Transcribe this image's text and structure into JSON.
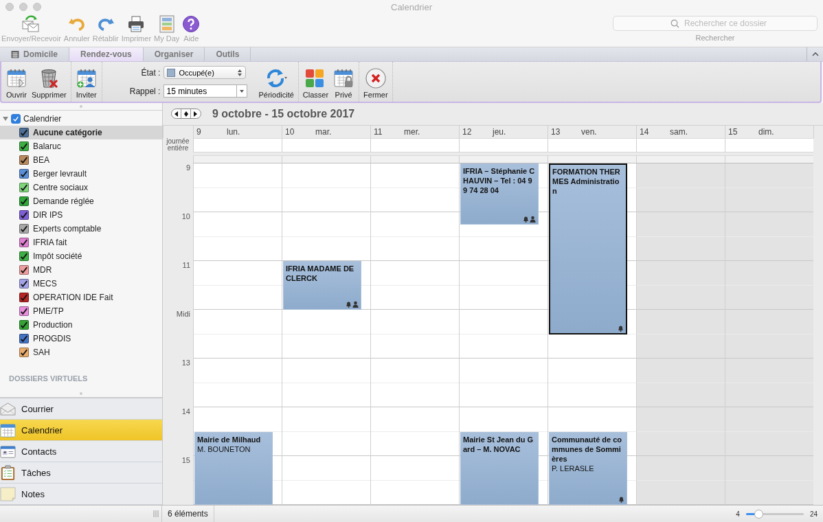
{
  "window": {
    "title": "Calendrier"
  },
  "toolbar": {
    "buttons": [
      {
        "label": "Envoyer/Recevoir"
      },
      {
        "label": "Annuler"
      },
      {
        "label": "Rétablir"
      },
      {
        "label": "Imprimer"
      },
      {
        "label": "My Day"
      },
      {
        "label": "Aide"
      }
    ],
    "search": {
      "placeholder": "Rechercher ce dossier",
      "label": "Rechercher"
    }
  },
  "ribbon_tabs": [
    {
      "label": "Domicile",
      "selected": false
    },
    {
      "label": "Rendez-vous",
      "selected": true
    },
    {
      "label": "Organiser",
      "selected": false
    },
    {
      "label": "Outils",
      "selected": false
    }
  ],
  "ribbon": {
    "open": "Ouvrir",
    "delete": "Supprimer",
    "invite": "Inviter",
    "status": {
      "label": "État :",
      "value": "Occupé(e)"
    },
    "reminder": {
      "label": "Rappel :",
      "value": "15 minutes"
    },
    "recurrence": "Périodicité",
    "categorize": "Classer",
    "private": "Privé",
    "close": "Fermer"
  },
  "sidebar": {
    "tree": [
      {
        "label": "Calendrier",
        "checked": true,
        "expanded": true,
        "children": [
          {
            "label": "Aucune catégorie",
            "checked": true,
            "selected": true,
            "color": "#4d6f96"
          },
          {
            "label": "Balaruc",
            "checked": true,
            "selected": false,
            "color": "#3fae44"
          },
          {
            "label": "BEA",
            "checked": true,
            "selected": false,
            "color": "#b8895e"
          },
          {
            "label": "Berger levrault",
            "checked": true,
            "selected": false,
            "color": "#5b8fd6"
          },
          {
            "label": "Centre sociaux",
            "checked": true,
            "selected": false,
            "color": "#7fd47c"
          },
          {
            "label": "Demande réglée",
            "checked": true,
            "selected": false,
            "color": "#2fa53a"
          },
          {
            "label": "DIR IPS",
            "checked": true,
            "selected": false,
            "color": "#7d5fd3"
          },
          {
            "label": "Experts comptable",
            "checked": true,
            "selected": false,
            "color": "#a8a8a8"
          },
          {
            "label": "IFRIA fait",
            "checked": true,
            "selected": false,
            "color": "#de7fd0"
          },
          {
            "label": "Impôt société",
            "checked": true,
            "selected": false,
            "color": "#3fae44"
          },
          {
            "label": "MDR",
            "checked": true,
            "selected": false,
            "color": "#ee9d9d"
          },
          {
            "label": "MECS",
            "checked": true,
            "selected": false,
            "color": "#a3a3e8"
          },
          {
            "label": "OPERATION IDE Fait",
            "checked": true,
            "selected": false,
            "color": "#b52525"
          },
          {
            "label": "PME/TP",
            "checked": true,
            "selected": false,
            "color": "#e78ddb"
          },
          {
            "label": "Production",
            "checked": true,
            "selected": false,
            "color": "#33a336"
          },
          {
            "label": "PROGDIS",
            "checked": true,
            "selected": false,
            "color": "#4573c4"
          },
          {
            "label": "SAH",
            "checked": true,
            "selected": false,
            "color": "#e8ab6c"
          }
        ]
      }
    ],
    "section": "DOSSIERS VIRTUELS",
    "nav": [
      {
        "label": "Courrier",
        "selected": false
      },
      {
        "label": "Calendrier",
        "selected": true
      },
      {
        "label": "Contacts",
        "selected": false
      },
      {
        "label": "Tâches",
        "selected": false
      },
      {
        "label": "Notes",
        "selected": false
      }
    ]
  },
  "calendar": {
    "range": "9 octobre - 15 octobre 2017",
    "all_day_label": "journée entière",
    "days": [
      {
        "number": "9",
        "name": "lun.",
        "weekend": false,
        "events": [
          {
            "title": "Mairie de Milhaud",
            "subtitle": "M. BOUNETON",
            "reminder": false,
            "attendees": false,
            "selected": false
          }
        ]
      },
      {
        "number": "10",
        "name": "mar.",
        "weekend": false,
        "events": [
          {
            "title": "IFRIA MADAME DE CLERCK",
            "reminder": true,
            "attendees": true,
            "selected": false
          }
        ]
      },
      {
        "number": "11",
        "name": "mer.",
        "weekend": false
      },
      {
        "number": "12",
        "name": "jeu.",
        "weekend": false,
        "events": [
          {
            "title": "IFRIA – Stéphanie CHAUVIN – Tel : 04 99 74 28 04",
            "reminder": true,
            "attendees": true,
            "selected": false
          },
          {
            "title": "Mairie St Jean du Gard – M. NOVAC",
            "reminder": false,
            "attendees": false,
            "selected": false
          }
        ]
      },
      {
        "number": "13",
        "name": "ven.",
        "weekend": false,
        "events": [
          {
            "title": "FORMATION THERMES Administration",
            "reminder": true,
            "attendees": false,
            "selected": true
          },
          {
            "title": "Communauté de communes de Sommières",
            "subtitle": "P. LERASLE",
            "reminder": true,
            "attendees": false,
            "selected": false
          }
        ]
      },
      {
        "number": "14",
        "name": "sam.",
        "weekend": true
      },
      {
        "number": "15",
        "name": "dim.",
        "weekend": true
      }
    ],
    "hours": [
      "9",
      "10",
      "11",
      "Midi",
      "13",
      "14",
      "15"
    ]
  },
  "status_bar": {
    "count": "6 éléments",
    "zoom": {
      "min": "4",
      "max": "24",
      "level": 0.22
    }
  }
}
